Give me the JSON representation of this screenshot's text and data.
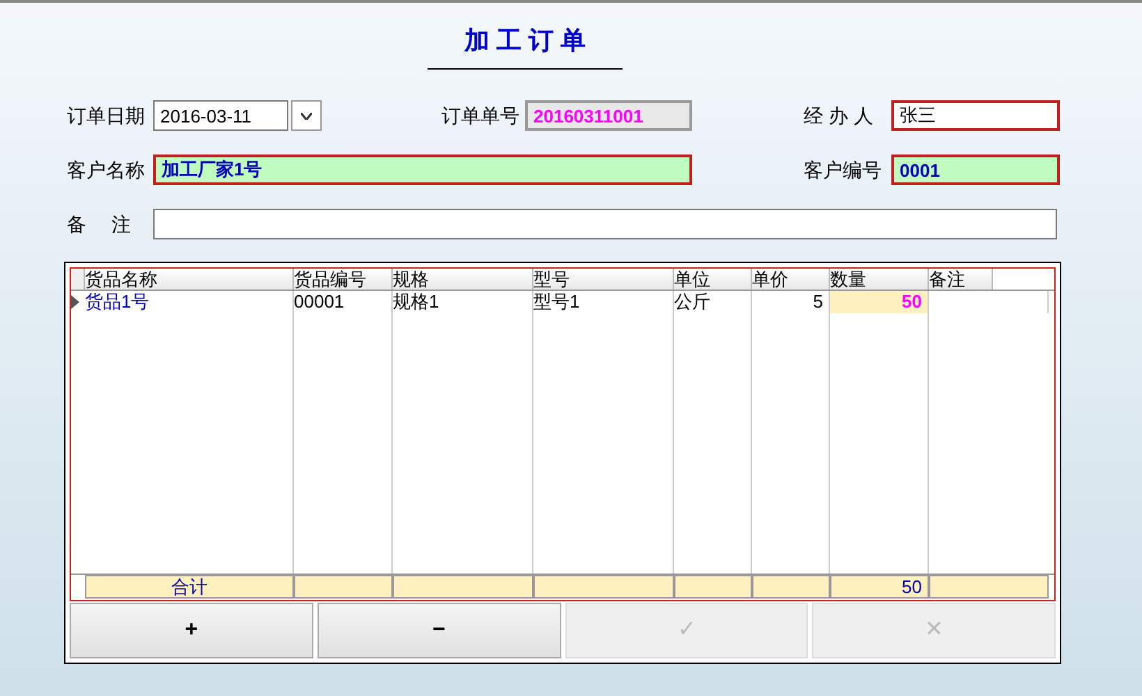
{
  "title": "加 工 订 单",
  "fields": {
    "order_date": {
      "label": "订单日期",
      "value": "2016-03-11"
    },
    "order_no": {
      "label": "订单单号",
      "value": "20160311001"
    },
    "handler": {
      "label": "经 办 人",
      "value": "张三"
    },
    "customer_name": {
      "label": "客户名称",
      "value": "加工厂家1号"
    },
    "customer_no": {
      "label": "客户编号",
      "value": "0001"
    },
    "remark": {
      "label": "备　 注"
    }
  },
  "table": {
    "columns": [
      "货品名称",
      "货品编号",
      "规格",
      "型号",
      "单位",
      "单价",
      "数量",
      "备注"
    ],
    "rows": [
      {
        "selected": true,
        "cells": [
          "货品1号",
          "00001",
          "规格1",
          "型号1",
          "公斤",
          "5",
          "50",
          ""
        ]
      }
    ],
    "totals": {
      "label": "合计",
      "quantity": "50"
    }
  },
  "buttons": [
    {
      "label": "+",
      "disabled": false
    },
    {
      "label": "−",
      "disabled": false
    },
    {
      "label": "✓",
      "disabled": true
    },
    {
      "label": "✕",
      "disabled": true
    }
  ]
}
